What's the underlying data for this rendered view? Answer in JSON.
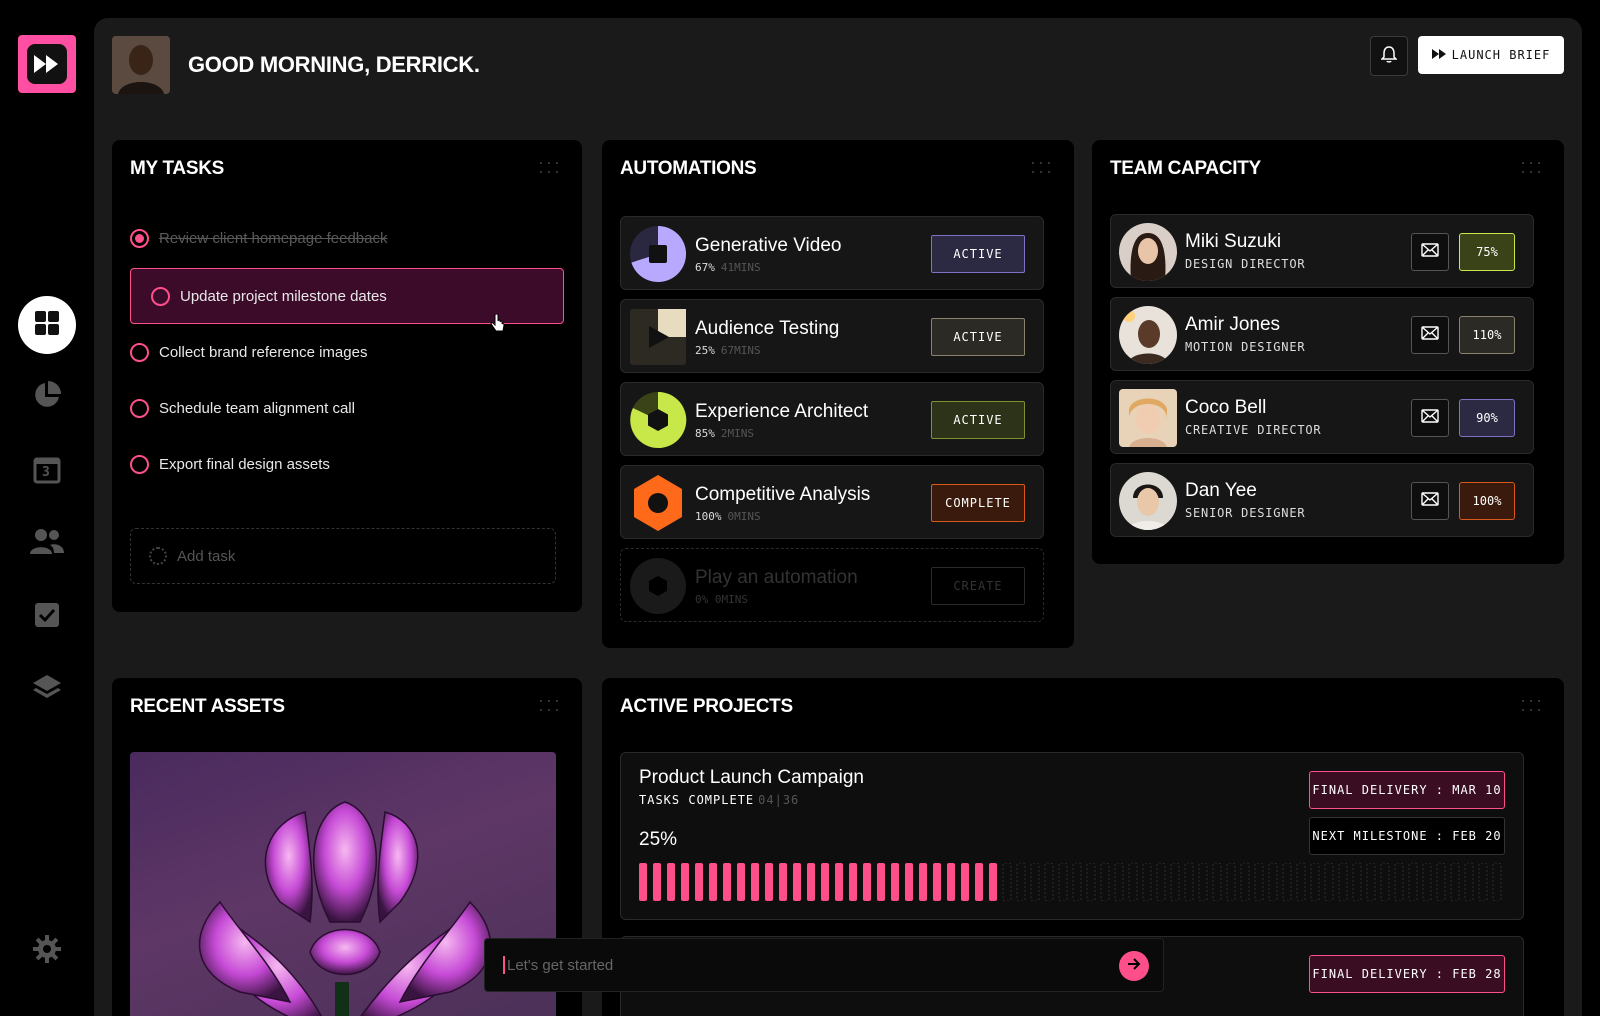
{
  "header": {
    "greeting": "GOOD MORNING, DERRICK.",
    "launch_label": "LAUNCH BRIEF"
  },
  "sidebar": {
    "items": [
      {
        "name": "dashboard",
        "icon": "grid-icon",
        "active": true
      },
      {
        "name": "analytics",
        "icon": "pie-chart-icon"
      },
      {
        "name": "calendar",
        "icon": "calendar-icon",
        "day": "3"
      },
      {
        "name": "team",
        "icon": "users-icon"
      },
      {
        "name": "tasks",
        "icon": "checkbox-icon"
      },
      {
        "name": "layers",
        "icon": "layers-icon"
      },
      {
        "name": "settings",
        "icon": "gear-icon"
      }
    ]
  },
  "tasks": {
    "title": "MY TASKS",
    "items": [
      {
        "label": "Review client homepage feedback",
        "done": true
      },
      {
        "label": "Update project milestone dates",
        "done": false,
        "highlighted": true
      },
      {
        "label": "Collect brand reference images",
        "done": false
      },
      {
        "label": "Schedule team alignment call",
        "done": false
      },
      {
        "label": "Export final design assets",
        "done": false
      }
    ],
    "add_placeholder": "Add task"
  },
  "automations": {
    "title": "AUTOMATIONS",
    "items": [
      {
        "name": "Generative Video",
        "percent": "67%",
        "time": "41MINS",
        "status": "ACTIVE",
        "color": "#b8a9ff",
        "progress": 0.67
      },
      {
        "name": "Audience Testing",
        "percent": "25%",
        "time": "67MINS",
        "status": "ACTIVE",
        "color": "#e8dcc0",
        "progress": 0.25
      },
      {
        "name": "Experience Architect",
        "percent": "85%",
        "time": "2MINS",
        "status": "ACTIVE",
        "color": "#c8e84a",
        "progress": 0.85
      },
      {
        "name": "Competitive Analysis",
        "percent": "100%",
        "time": "0MINS",
        "status": "COMPLETE",
        "color": "#ff6a1a",
        "progress": 1.0
      }
    ],
    "placeholder": {
      "name": "Play an automation",
      "percent": "0%",
      "time": "0MINS",
      "status": "CREATE"
    }
  },
  "team": {
    "title": "TEAM CAPACITY",
    "members": [
      {
        "name": "Miki Suzuki",
        "role": "DESIGN DIRECTOR",
        "capacity": "75%",
        "color": "#c8e84a"
      },
      {
        "name": "Amir Jones",
        "role": "MOTION DESIGNER",
        "capacity": "110%",
        "color": "#e8dcc0"
      },
      {
        "name": "Coco Bell",
        "role": "CREATIVE DIRECTOR",
        "capacity": "90%",
        "color": "#b8a9ff"
      },
      {
        "name": "Dan Yee",
        "role": "SENIOR DESIGNER",
        "capacity": "100%",
        "color": "#ff6a1a"
      }
    ]
  },
  "assets": {
    "title": "RECENT ASSETS"
  },
  "projects": {
    "title": "ACTIVE PROJECTS",
    "items": [
      {
        "name": "Product Launch Campaign",
        "tasks_label": "TASKS COMPLETE",
        "tasks_count": "04|36",
        "percent": "25%",
        "progress": 0.25,
        "final_delivery": "FINAL DELIVERY : MAR 10",
        "next_milestone": "NEXT MILESTONE : FEB 20"
      },
      {
        "final_delivery": "FINAL DELIVERY : FEB 28"
      }
    ]
  },
  "chat": {
    "placeholder": "Let's get started"
  },
  "colors": {
    "accent": "#ff4f8a",
    "brand": "#ff4fa3"
  }
}
